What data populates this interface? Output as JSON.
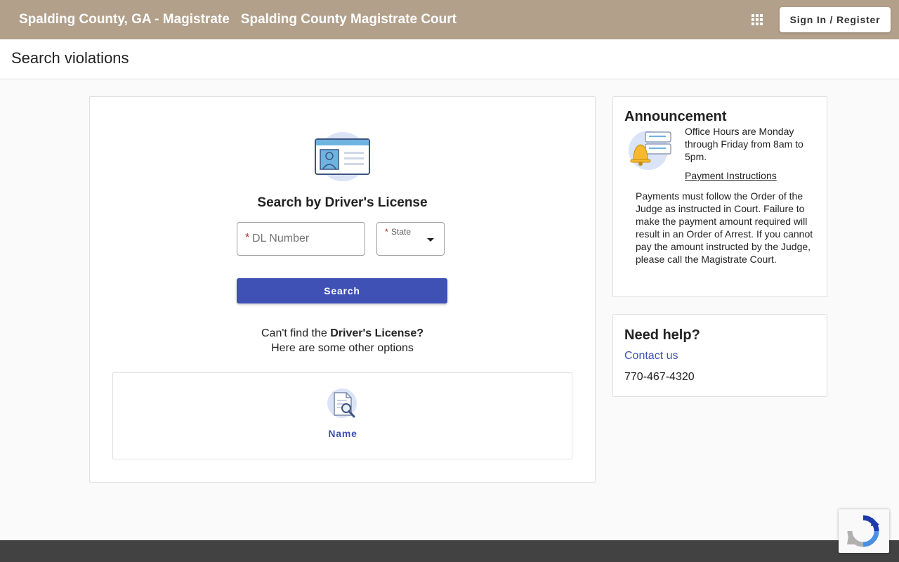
{
  "header": {
    "brand": "Spalding County, GA - Magistrate",
    "court_name": "Spalding County Magistrate Court",
    "apps_icon": "apps-grid-icon",
    "signin_label": "Sign In / Register"
  },
  "page": {
    "title": "Search violations"
  },
  "search": {
    "icon": "drivers-license-icon",
    "heading": "Search by Driver's License",
    "dl_required_marker": "*",
    "dl_placeholder": "DL Number",
    "dl_value": "",
    "state_required_marker": "*",
    "state_label": "State",
    "state_value": "",
    "button_label": "Search",
    "cantfind_prefix": "Can't find the ",
    "cantfind_bold": "Driver's License?",
    "cantfind_line2": "Here are some other options",
    "options": [
      {
        "icon": "name-search-icon",
        "label": "Name"
      }
    ]
  },
  "announcement": {
    "title": "Announcement",
    "icon": "bell-icon",
    "office_hours": "Office Hours are Monday through Friday from 8am to 5pm.",
    "payment_link": "Payment Instructions",
    "payment_text": "Payments must follow the Order of the Judge as instructed in Court. Failure to make the payment amount required will result in an Order of Arrest. If you cannot pay the amount instructed by the Judge, please call the Magistrate Court."
  },
  "help": {
    "title": "Need help?",
    "contact_label": "Contact us",
    "phone": "770-467-4320"
  },
  "colors": {
    "header_bg": "#b2a08b",
    "primary": "#3f51b5",
    "required": "#b71c1c",
    "footer_bg": "#424242"
  }
}
